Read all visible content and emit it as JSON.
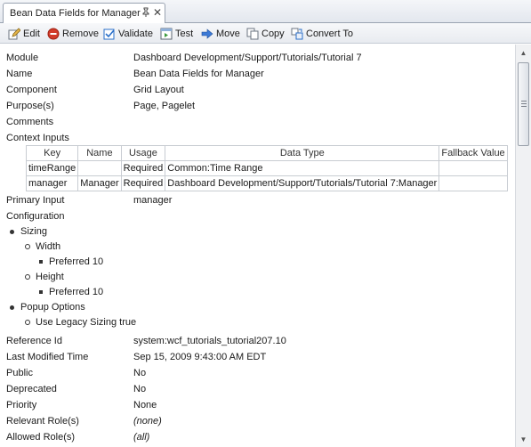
{
  "tab": {
    "title": "Bean Data Fields for Manager",
    "pin_glyph": "📌",
    "close_glyph": "✕"
  },
  "toolbar": {
    "edit": "Edit",
    "remove": "Remove",
    "validate": "Validate",
    "test": "Test",
    "move": "Move",
    "copy": "Copy",
    "convert": "Convert To"
  },
  "fields": {
    "module_label": "Module",
    "module_value": "Dashboard Development/Support/Tutorials/Tutorial 7",
    "name_label": "Name",
    "name_value": "Bean Data Fields for Manager",
    "component_label": "Component",
    "component_value": "Grid Layout",
    "purpose_label": "Purpose(s)",
    "purpose_value": "Page, Pagelet",
    "comments_label": "Comments",
    "context_inputs_label": "Context Inputs",
    "primary_input_label": "Primary Input",
    "primary_input_value": "manager",
    "configuration_label": "Configuration",
    "reference_id_label": "Reference Id",
    "reference_id_value": "system:wcf_tutorials_tutorial207.10",
    "last_modified_label": "Last Modified Time",
    "last_modified_value": "Sep 15, 2009 9:43:00 AM EDT",
    "public_label": "Public",
    "public_value": "No",
    "deprecated_label": "Deprecated",
    "deprecated_value": "No",
    "priority_label": "Priority",
    "priority_value": "None",
    "relevant_roles_label": "Relevant Role(s)",
    "relevant_roles_value": "(none)",
    "allowed_roles_label": "Allowed Role(s)",
    "allowed_roles_value": "(all)"
  },
  "context_table": {
    "headers": [
      "Key",
      "Name",
      "Usage",
      "Data Type",
      "Fallback Value"
    ],
    "rows": [
      [
        "timeRange",
        "",
        "Required",
        "Common:Time Range",
        ""
      ],
      [
        "manager",
        "Manager",
        "Required",
        "Dashboard Development/Support/Tutorials/Tutorial 7:Manager",
        ""
      ]
    ]
  },
  "configuration": {
    "sizing": "Sizing",
    "width": "Width",
    "width_preferred_label": "Preferred",
    "width_preferred_value": "10",
    "height": "Height",
    "height_preferred_label": "Preferred",
    "height_preferred_value": "10",
    "popup_options": "Popup Options",
    "legacy_label": "Use Legacy Sizing",
    "legacy_value": "true"
  },
  "colors": {
    "accent_blue": "#2a6fc9",
    "remove_red": "#d23b2a",
    "border": "#9aa3b1"
  },
  "icons": [
    "pencil-icon",
    "remove-icon",
    "validate-icon",
    "test-icon",
    "move-arrow-icon",
    "copy-icon",
    "convert-icon",
    "pin-icon",
    "close-icon"
  ]
}
